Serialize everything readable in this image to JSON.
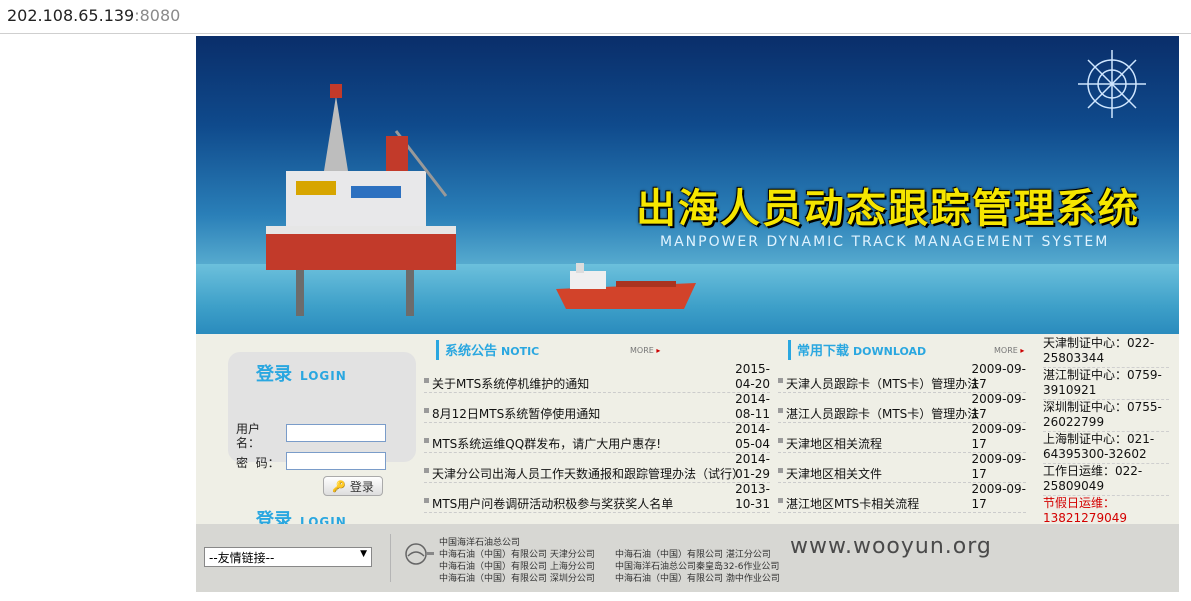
{
  "address_bar": {
    "host": "202.108.65.139",
    "port": ":8080"
  },
  "banner": {
    "title_cn": "出海人员动态跟踪管理系统",
    "title_en": "MANPOWER DYNAMIC TRACK MANAGEMENT SYSTEM"
  },
  "login": {
    "title_cn": "登录",
    "title_en": "LOGIN",
    "username_label": "用户名：",
    "password_label": "密  码：",
    "submit_label": "登录"
  },
  "notice": {
    "title_cn": "系统公告",
    "title_en": "NOTIC",
    "more": "MORE",
    "items": [
      {
        "text": "关于MTS系统停机维护的通知",
        "date1": "2015-",
        "date2": "04-20"
      },
      {
        "text": "8月12日MTS系统暂停使用通知",
        "date1": "2014-",
        "date2": "08-11"
      },
      {
        "text": "MTS系统运维QQ群发布，请广大用户惠存!",
        "date1": "2014-",
        "date2": "05-04"
      },
      {
        "text": "天津分公司出海人员工作天数通报和跟踪管理办法（试行）",
        "date1": "2014-",
        "date2": "01-29"
      },
      {
        "text": "MTS用户问卷调研活动积极参与奖获奖人名单",
        "date1": "2013-",
        "date2": "10-31"
      }
    ]
  },
  "download": {
    "title_cn": "常用下载",
    "title_en": "DOWNLOAD",
    "more": "MORE",
    "items": [
      {
        "text": "天津人员跟踪卡（MTS卡）管理办法",
        "date1": "2009-09-",
        "date2": "17"
      },
      {
        "text": "湛江人员跟踪卡（MTS卡）管理办法",
        "date1": "2009-09-",
        "date2": "17"
      },
      {
        "text": "天津地区相关流程",
        "date1": "2009-09-",
        "date2": "17"
      },
      {
        "text": "天津地区相关文件",
        "date1": "2009-09-",
        "date2": "17"
      },
      {
        "text": "湛江地区MTS卡相关流程",
        "date1": "2009-09-",
        "date2": "17"
      }
    ]
  },
  "contacts": [
    {
      "l1": "天津制证中心：022-",
      "l2": "25803344"
    },
    {
      "l1": "湛江制证中心：0759-",
      "l2": "3910921"
    },
    {
      "l1": "深圳制证中心：0755-",
      "l2": "26022799"
    },
    {
      "l1": "上海制证中心：021-",
      "l2": "64395300-32602"
    },
    {
      "l1": "工作日运维：022-",
      "l2": "25809049"
    },
    {
      "l1": "节假日运维：",
      "l2": "13821279049"
    }
  ],
  "footer": {
    "friend_links": "--友情链接--",
    "company_head": "中国海洋石油总公司",
    "col1": [
      "中海石油（中国）有限公司 天津分公司",
      "中海石油（中国）有限公司 上海分公司",
      "中海石油（中国）有限公司 深圳分公司"
    ],
    "col2": [
      "中海石油（中国）有限公司 湛江分公司",
      "中国海洋石油总公司秦皇岛32-6作业公司",
      "中海石油（中国）有限公司 渤中作业公司"
    ]
  },
  "watermark": "www.wooyun.org"
}
